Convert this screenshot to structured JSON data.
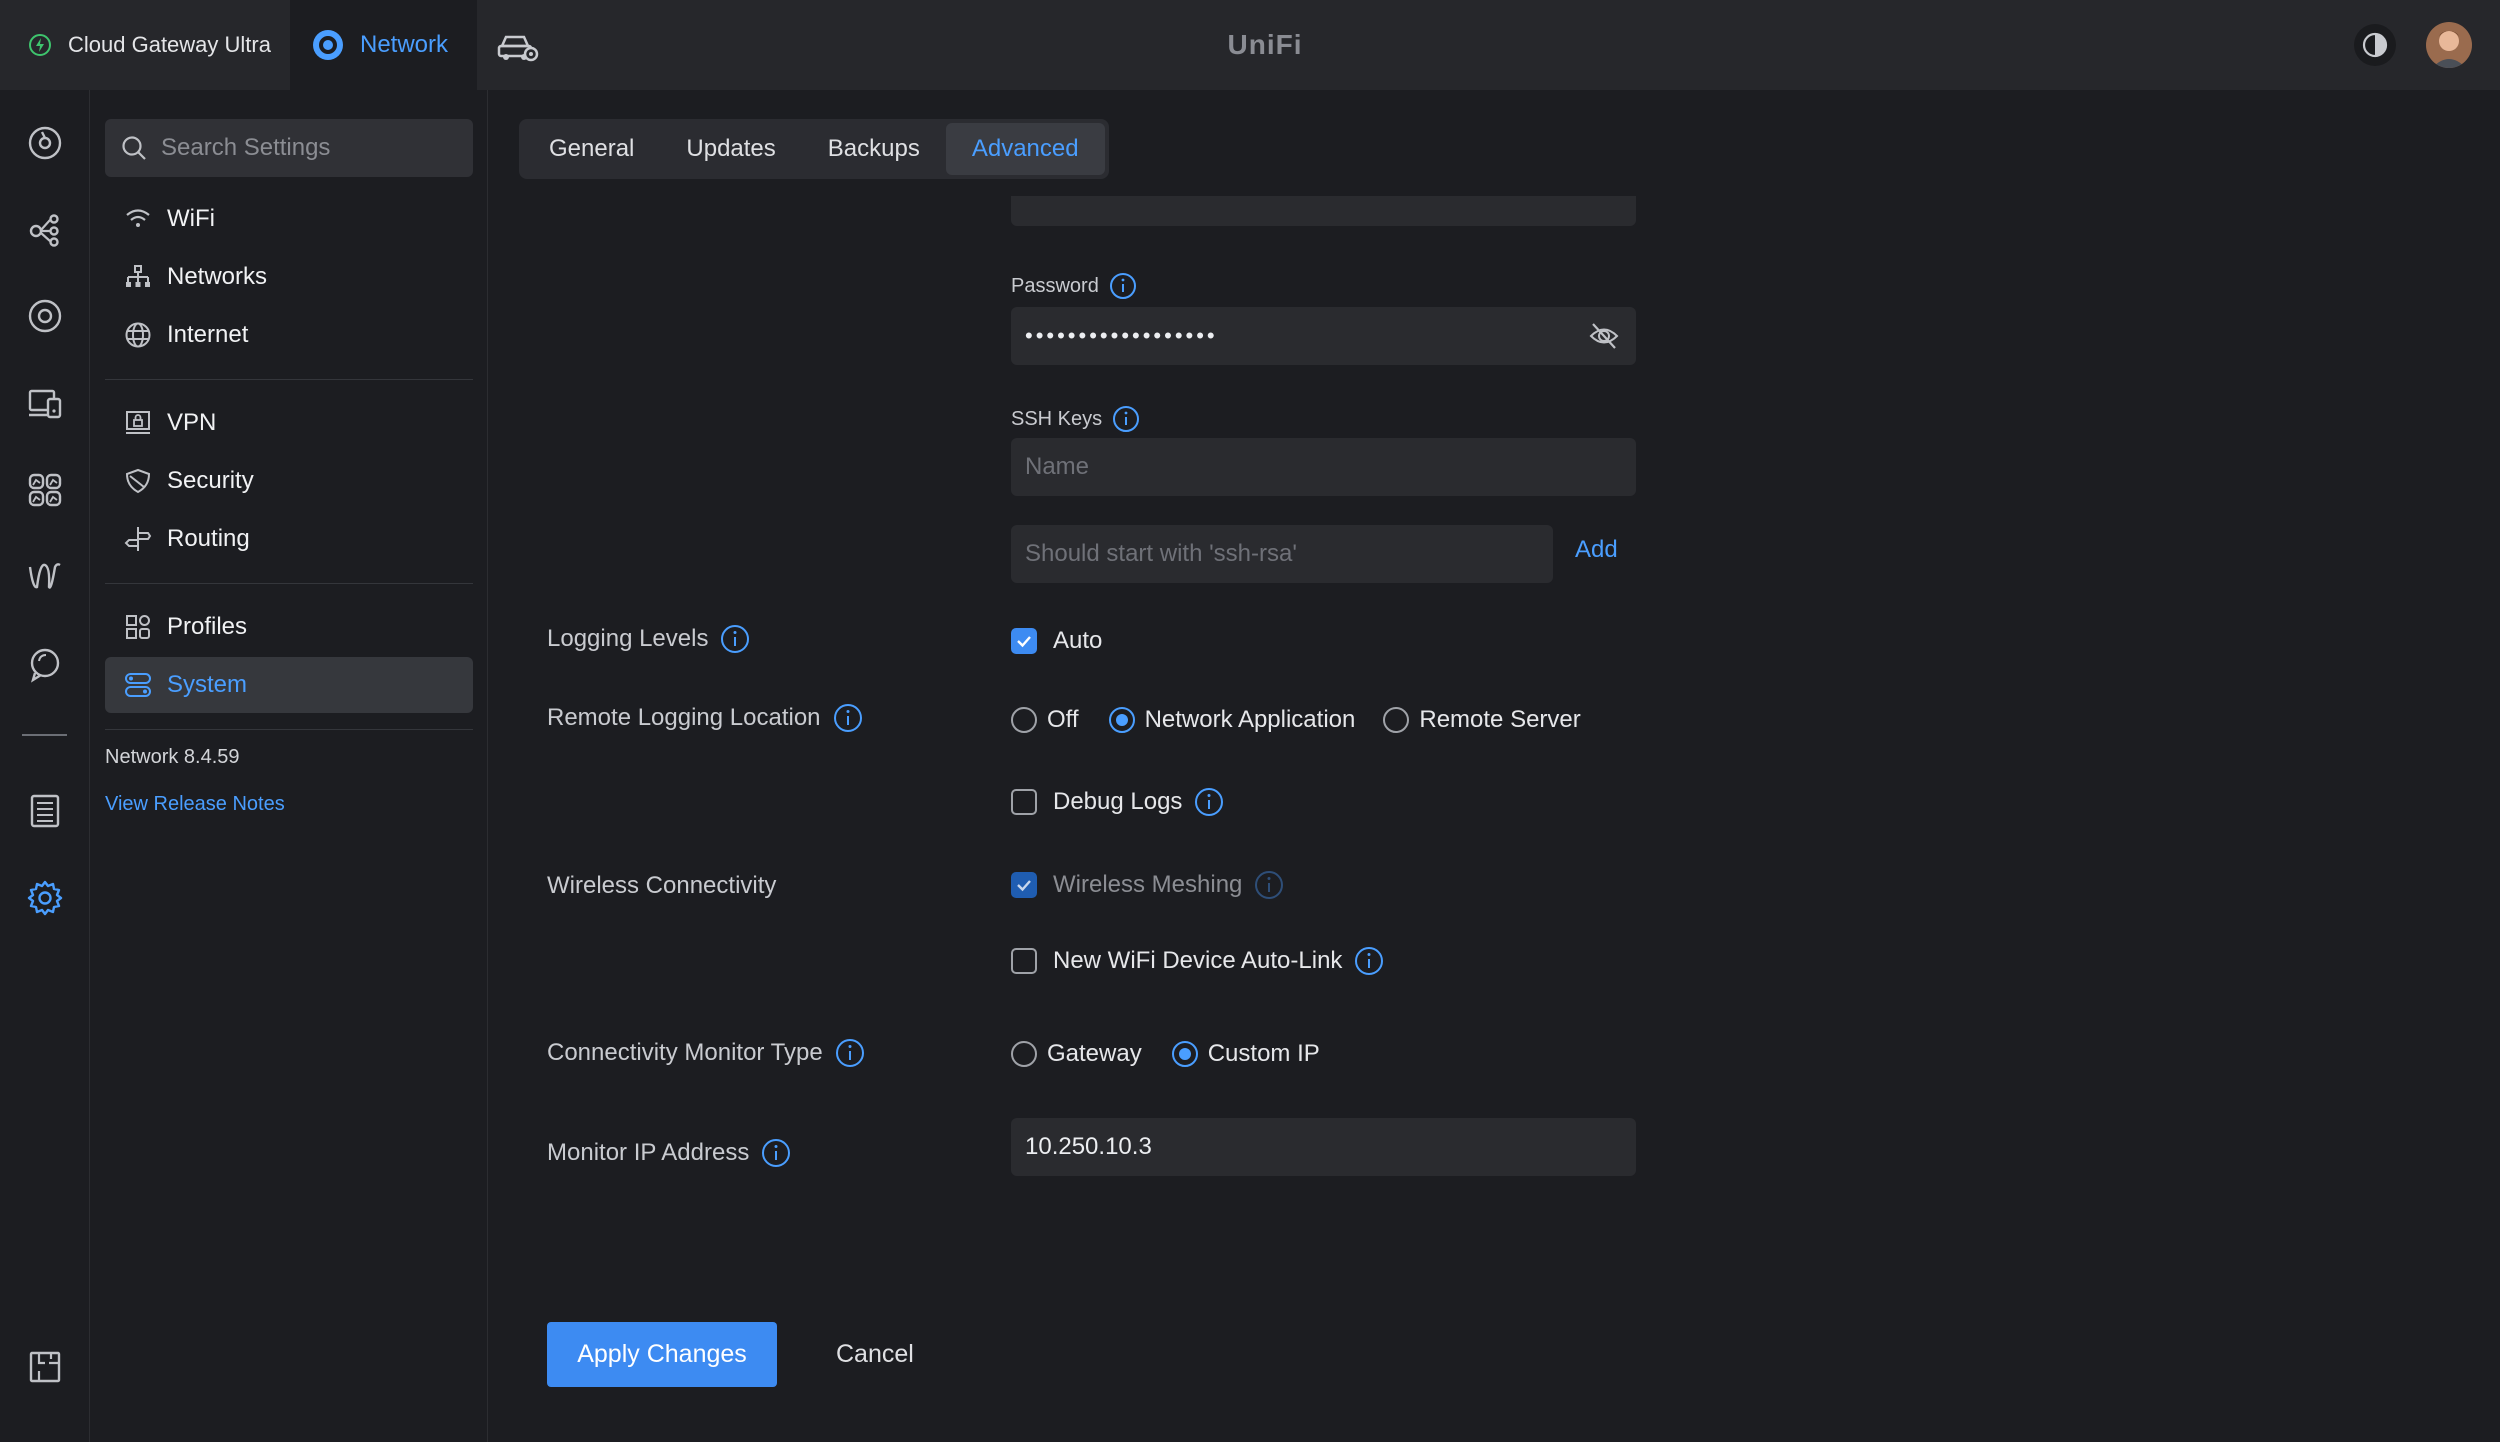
{
  "topbar": {
    "console_name": "Cloud Gateway Ultra",
    "app_name": "Network",
    "brand": "UniFi"
  },
  "rail": {
    "items": [
      "dashboard-icon",
      "topology-icon",
      "unifi-devices-icon",
      "client-devices-icon",
      "statistics-icon",
      "insights-icon",
      "alerts-icon",
      "system-log-icon",
      "settings-icon",
      "innerspace-icon"
    ]
  },
  "sidebar": {
    "search_placeholder": "Search Settings",
    "groups": [
      [
        {
          "label": "WiFi",
          "icon": "wifi-icon"
        },
        {
          "label": "Networks",
          "icon": "networks-icon"
        },
        {
          "label": "Internet",
          "icon": "globe-icon"
        }
      ],
      [
        {
          "label": "VPN",
          "icon": "vpn-icon"
        },
        {
          "label": "Security",
          "icon": "shield-icon"
        },
        {
          "label": "Routing",
          "icon": "routing-icon"
        }
      ],
      [
        {
          "label": "Profiles",
          "icon": "profiles-icon"
        },
        {
          "label": "System",
          "icon": "system-icon",
          "active": true
        }
      ]
    ],
    "version": "Network 8.4.59",
    "release_notes": "View Release Notes"
  },
  "tabs": [
    {
      "label": "General"
    },
    {
      "label": "Updates"
    },
    {
      "label": "Backups"
    },
    {
      "label": "Advanced",
      "active": true
    }
  ],
  "form": {
    "password_label": "Password",
    "password_value": "••••••••••••••••••",
    "ssh_keys_label": "SSH Keys",
    "ssh_name_placeholder": "Name",
    "ssh_key_placeholder": "Should start with 'ssh-rsa'",
    "ssh_add": "Add",
    "logging_levels_label": "Logging Levels",
    "logging_auto": "Auto",
    "remote_logging_label": "Remote Logging Location",
    "remote_logging_options": [
      "Off",
      "Network Application",
      "Remote Server"
    ],
    "remote_logging_selected": "Network Application",
    "debug_logs": "Debug Logs",
    "wireless_label": "Wireless Connectivity",
    "wireless_meshing": "Wireless Meshing",
    "auto_link": "New WiFi Device Auto-Link",
    "monitor_type_label": "Connectivity Monitor Type",
    "monitor_type_options": [
      "Gateway",
      "Custom IP"
    ],
    "monitor_type_selected": "Custom IP",
    "monitor_ip_label": "Monitor IP Address",
    "monitor_ip_value": "10.250.10.3"
  },
  "actions": {
    "apply": "Apply Changes",
    "cancel": "Cancel"
  },
  "colors": {
    "accent": "#4a9eff",
    "background": "#1c1d21",
    "topbar": "#26272b",
    "input": "#2a2b2f"
  }
}
